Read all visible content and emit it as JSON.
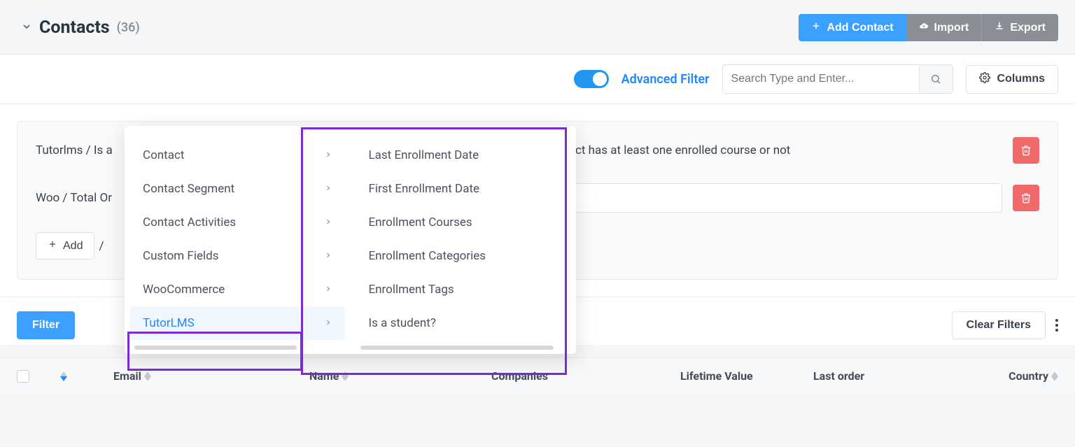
{
  "header": {
    "title": "Contacts",
    "count": "(36)",
    "add_label": "Add Contact",
    "import_label": "Import",
    "export_label": "Export"
  },
  "toolbar": {
    "advanced_filter": "Advanced Filter",
    "search_placeholder": "Search Type and Enter...",
    "columns_label": "Columns"
  },
  "filters": {
    "row1_prefix": "Tutorlms / Is a",
    "row1_suffix": "act has at least one enrolled course or not",
    "row2_prefix": "Woo / Total Or",
    "add_label": "Add",
    "add_tail": "/"
  },
  "actions": {
    "filter": "Filter",
    "clear": "Clear Filters"
  },
  "table": {
    "col_email": "Email",
    "col_name": "Name",
    "col_companies": "Companies",
    "col_lifetime": "Lifetime Value",
    "col_last_order": "Last order",
    "col_country": "Country"
  },
  "popover": {
    "left": [
      "Contact",
      "Contact Segment",
      "Contact Activities",
      "Custom Fields",
      "WooCommerce",
      "TutorLMS"
    ],
    "right": [
      "Last Enrollment Date",
      "First Enrollment Date",
      "Enrollment Courses",
      "Enrollment Categories",
      "Enrollment Tags",
      "Is a student?"
    ],
    "active_left_index": 5
  }
}
